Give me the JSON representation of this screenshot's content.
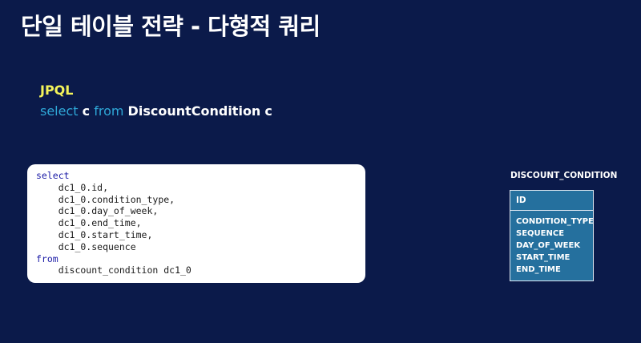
{
  "slide": {
    "title": "단일 테이블 전략 - 다형적 쿼리"
  },
  "jpql": {
    "label": "JPQL",
    "select_kw": "select",
    "alias1": "c",
    "from_kw": "from",
    "entity": "DiscountCondition",
    "alias2": "c"
  },
  "sql": {
    "lines": [
      "select",
      "    dc1_0.id,",
      "    dc1_0.condition_type,",
      "    dc1_0.day_of_week,",
      "    dc1_0.end_time,",
      "    dc1_0.start_time,",
      "    dc1_0.sequence",
      "from",
      "    discount_condition dc1_0"
    ]
  },
  "table": {
    "name": "DISCOUNT_CONDITION",
    "pk": "ID",
    "columns": [
      "CONDITION_TYPE",
      "SEQUENCE",
      "DAY_OF_WEEK",
      "START_TIME",
      "END_TIME"
    ]
  },
  "colors": {
    "background": "#0b1a4a",
    "jpql_label": "#f4f45a",
    "keyword": "#2fa8d8",
    "table_fill": "#25709e"
  }
}
